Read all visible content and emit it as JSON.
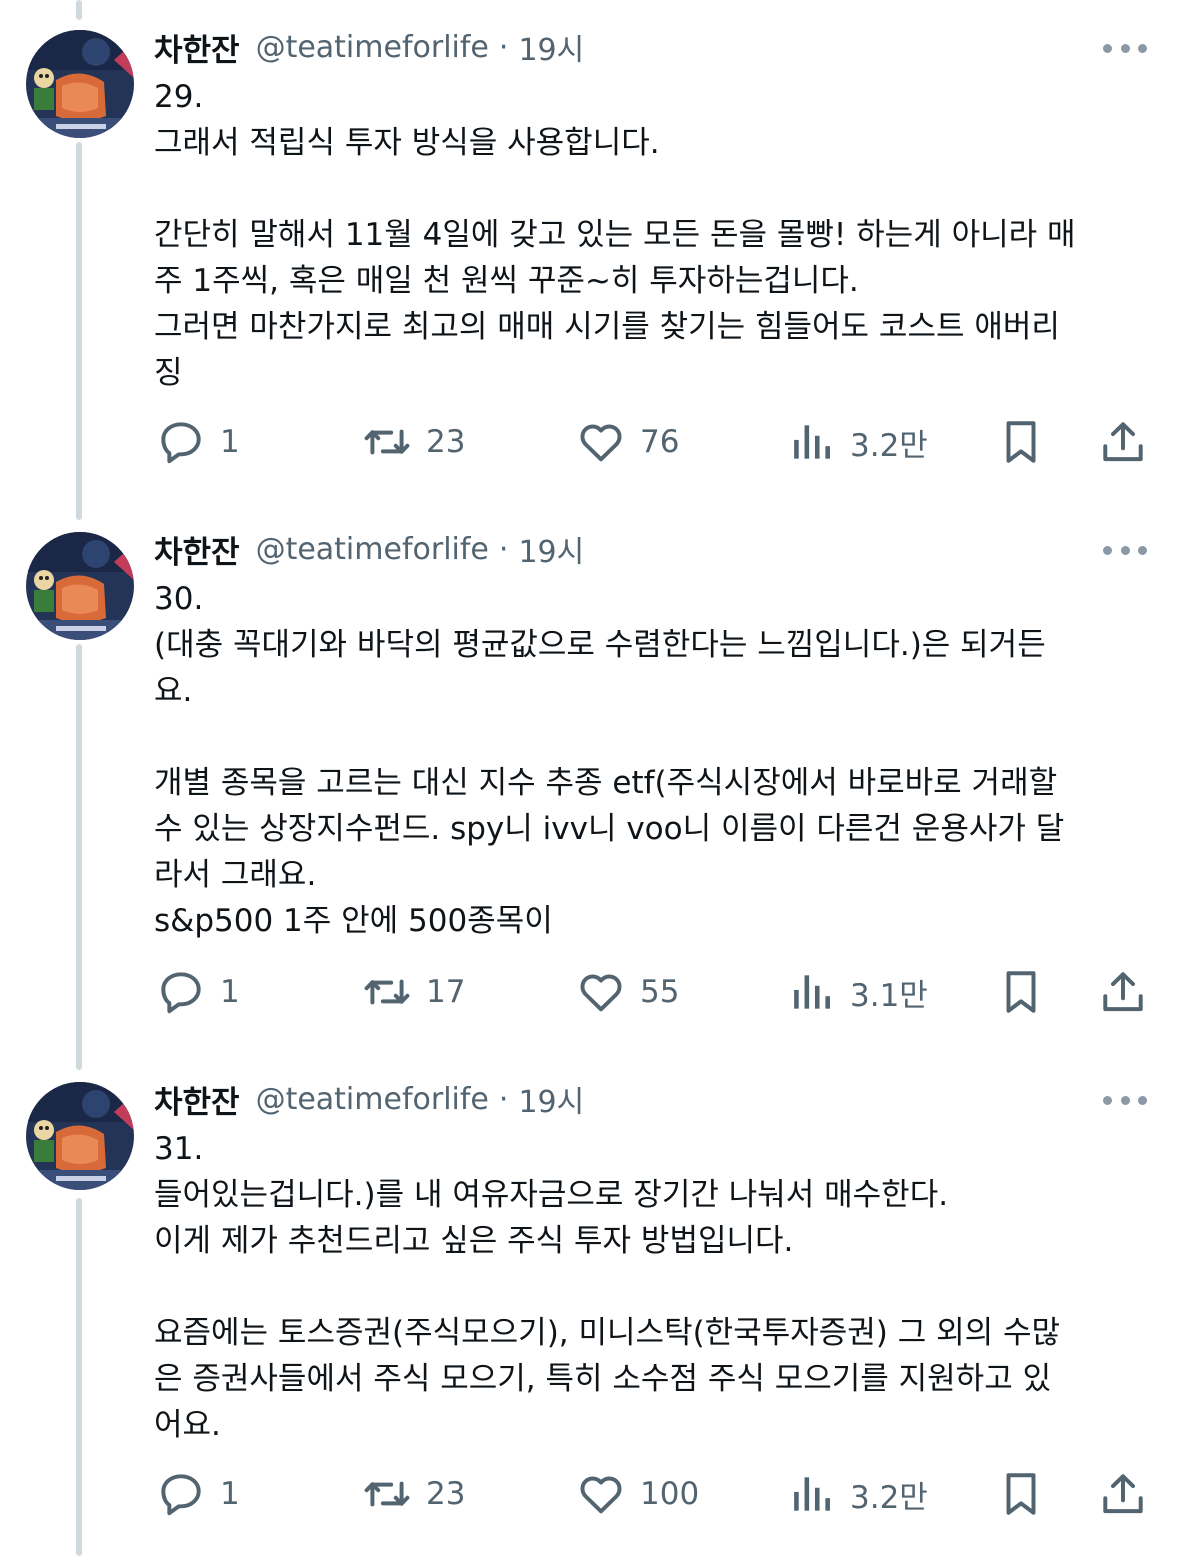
{
  "theme": {
    "accent": "#1d9bf0",
    "text": "#0f1419",
    "muted": "#536471",
    "thread_line": "#cfd9de"
  },
  "tweets": [
    {
      "author": {
        "name": "차한잔",
        "handle": "@teatimeforlife",
        "separator": "·",
        "time": "19시"
      },
      "lines": [
        "29.",
        "그래서 적립식 투자 방식을 사용합니다.",
        "",
        "간단히 말해서 11월 4일에 갖고 있는 모든 돈을 몰빵! 하는게 아니라 매",
        "주 1주씩, 혹은 매일 천 원씩 꾸준~히 투자하는겁니다.",
        "그러면 마찬가지로 최고의 매매 시기를 찾기는 힘들어도 코스트 애버리",
        "징"
      ],
      "stats": {
        "replies": "1",
        "retweets": "23",
        "likes": "76",
        "views": "3.2만"
      }
    },
    {
      "author": {
        "name": "차한잔",
        "handle": "@teatimeforlife",
        "separator": "·",
        "time": "19시"
      },
      "lines": [
        "30.",
        "(대충 꼭대기와 바닥의 평균값으로 수렴한다는 느낌입니다.)은 되거든",
        "요.",
        "",
        "개별 종목을 고르는 대신 지수 추종 etf(주식시장에서 바로바로 거래할",
        "수 있는 상장지수펀드. spy니 ivv니 voo니 이름이 다른건 운용사가 달",
        "라서 그래요.",
        "s&p500 1주 안에 500종목이"
      ],
      "stats": {
        "replies": "1",
        "retweets": "17",
        "likes": "55",
        "views": "3.1만"
      }
    },
    {
      "author": {
        "name": "차한잔",
        "handle": "@teatimeforlife",
        "separator": "·",
        "time": "19시"
      },
      "lines": [
        "31.",
        "들어있는겁니다.)를 내 여유자금으로 장기간 나눠서 매수한다.",
        "이게 제가 추천드리고 싶은 주식 투자 방법입니다.",
        "",
        "요즘에는 토스증권(주식모으기), 미니스탁(한국투자증권) 그 외의 수많",
        "은 증권사들에서 주식 모으기, 특히 소수점 주식 모으기를 지원하고 있",
        "어요."
      ],
      "stats": {
        "replies": "1",
        "retweets": "23",
        "likes": "100",
        "views": "3.2만"
      }
    }
  ],
  "icons": {
    "more": "more-icon",
    "reply": "reply-icon",
    "retweet": "retweet-icon",
    "like": "like-icon",
    "views": "views-icon",
    "bookmark": "bookmark-icon",
    "share": "share-icon"
  }
}
